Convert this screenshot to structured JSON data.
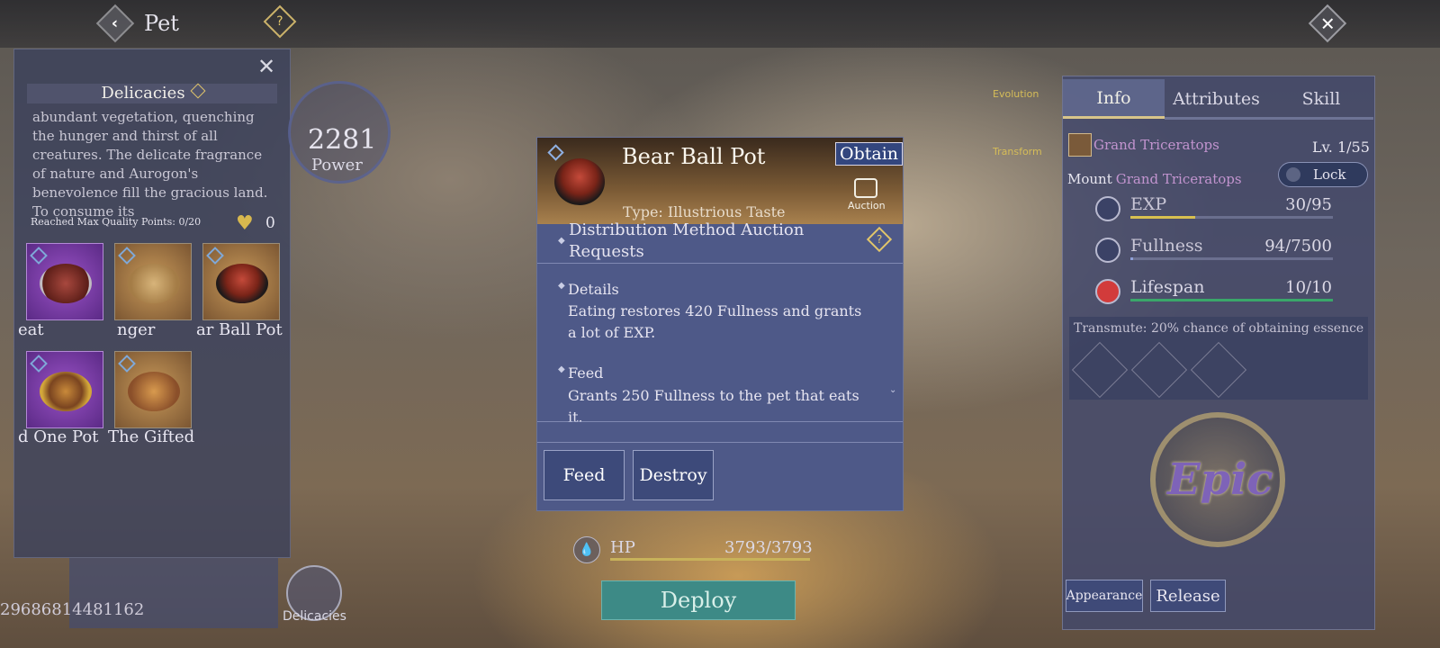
{
  "header": {
    "title": "Pet",
    "back_icon": "chevron-left-icon",
    "help_icon": "question-diamond-icon",
    "close_icon": "close-icon"
  },
  "left_panel": {
    "heading": "Delicacies",
    "description": "abundant vegetation, quenching the hunger and thirst of all creatures. The delicate fragrance of nature and Aurogon's benevolence fill the gracious land. To consume its",
    "quality_points": "Reached Max Quality Points: 0/20",
    "heart_count": "0",
    "items": [
      {
        "label": "eat",
        "rarity": "purple"
      },
      {
        "label": "nger",
        "rarity": "gold"
      },
      {
        "label": "ar Ball Pot",
        "rarity": "gold"
      },
      {
        "label": "d One Pot",
        "rarity": "purple"
      },
      {
        "label": "The Gifted",
        "rarity": "gold"
      }
    ]
  },
  "power": {
    "value": "2281",
    "label": "Power"
  },
  "side_labels": {
    "evolution": "Evolution",
    "transform": "Transform"
  },
  "modal": {
    "item_name": "Bear Ball Pot",
    "obtain_label": "Obtain",
    "auction_label": "Auction",
    "type": "Type: Illustrious Taste",
    "distribution": "Distribution Method    Auction Requests",
    "details_label": "Details",
    "details_text": "Eating restores 420 Fullness and grants a lot of EXP.",
    "feed_label": "Feed",
    "feed_text": "Grants 250 Fullness to the pet that eats it.",
    "buttons": {
      "feed": "Feed",
      "destroy": "Destroy"
    }
  },
  "bottom": {
    "hp_label": "HP",
    "hp_value": "3793/3793",
    "deploy_label": "Deploy",
    "id_number": "29686814481162",
    "delicacies_label": "Delicacies"
  },
  "right_panel": {
    "tabs": [
      "Info",
      "Attributes",
      "Skill"
    ],
    "active_tab": "Info",
    "species": "Grand Triceratops",
    "level": "Lv. 1/55",
    "mount_prefix": "Mount",
    "mount_name": "Grand Triceratops",
    "lock_label": "Lock",
    "stats": [
      {
        "label": "EXP",
        "value": "30/95",
        "fill": 0.32,
        "color": "#d8c050",
        "label_color": "#c9c6d6"
      },
      {
        "label": "Fullness",
        "value": "94/7500",
        "fill": 0.013,
        "color": "#8fa0d8",
        "label_color": "#c9c6d6"
      },
      {
        "label": "Lifespan",
        "value": "10/10",
        "fill": 1.0,
        "color": "#3aa76a",
        "label_color": "#d8d6e4"
      }
    ],
    "transmute": "Transmute: 20% chance of obtaining essence",
    "rarity_emblem": "Epic",
    "appearance_label": "Appearance",
    "release_label": "Release"
  },
  "colors": {
    "accent_gold": "#d8c58a",
    "panel_bg": "#4e5988",
    "deploy_green": "#3d8a86"
  }
}
